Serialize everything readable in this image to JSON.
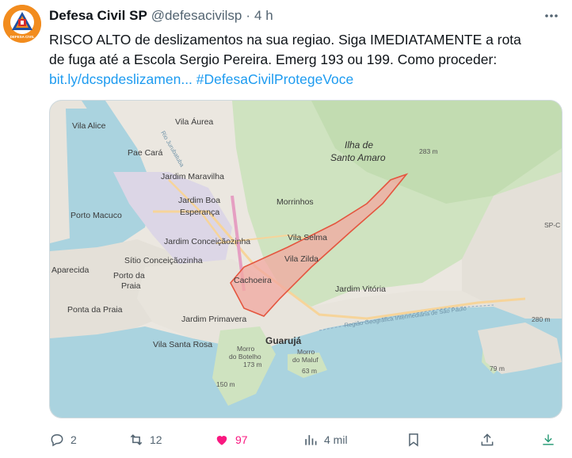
{
  "tweet": {
    "author_name": "Defesa Civil SP",
    "handle": "@defesacivilsp",
    "separator": "·",
    "time": "4 h",
    "text_line1": "RISCO ALTO de deslizamentos na sua regiao. Siga IMEDIATAMENTE a rota",
    "text_line2": "de fuga até a Escola Sergio Pereira. Emerg 193 ou 199. Como proceder:",
    "link_text": "bit.ly/dcspdeslizamen...",
    "hashtag": "#DefesaCivilProtegeVoce",
    "avatar_label": "DEFESA CIVIL"
  },
  "map": {
    "labels": {
      "vila_aurea": "Vila Áurea",
      "vila_alice": "Vila Alice",
      "pae_cara": "Pae Cará",
      "jardim_maravilha": "Jardim Maravilha",
      "jardim_boa": "Jardim Boa",
      "esperanca": "Esperança",
      "porto_macuco": "Porto Macuco",
      "jardim_conceicaozinha": "Jardim Conceiçãozinha",
      "sitio_conceicaozinha": "Sítio Conceiçãozinha",
      "porto_da": "Porto da",
      "praia": "Praia",
      "aparecida": "Aparecida",
      "ponta_da_praia": "Ponta da Praia",
      "cachoeira": "Cachoeira",
      "jardim_primavera": "Jardim Primavera",
      "vila_santa_rosa": "Vila Santa Rosa",
      "morrinhos": "Morrinhos",
      "vila_selma": "Vila Selma",
      "vila_zilda": "Vila Zilda",
      "jardim_vitoria": "Jardim Vitória",
      "guaruja": "Guarujá",
      "ilha_de": "Ilha de",
      "santo_amaro": "Santo Amaro",
      "m283": "283 m",
      "m280": "280 m",
      "morro_botelho_1": "Morro",
      "morro_botelho_2": "do Botelho",
      "m173": "173 m",
      "morro_maluf_1": "Morro",
      "morro_maluf_2": "do Maluf",
      "m63": "63 m",
      "m150": "150 m",
      "m79": "79 m",
      "sp_road": "SP-C",
      "sea_line": "Região Geográfica Intermediária de São Paulo",
      "rio_label": "Rio Jurubatuba"
    }
  },
  "actions": {
    "reply_count": "2",
    "retweet_count": "12",
    "like_count": "97",
    "views_count": "4 mil"
  },
  "colors": {
    "accent": "#1d9bf0",
    "like": "#f91880",
    "muted": "#536471",
    "risk_fill": "#f2a8a0",
    "risk_stroke": "#e4563f"
  }
}
